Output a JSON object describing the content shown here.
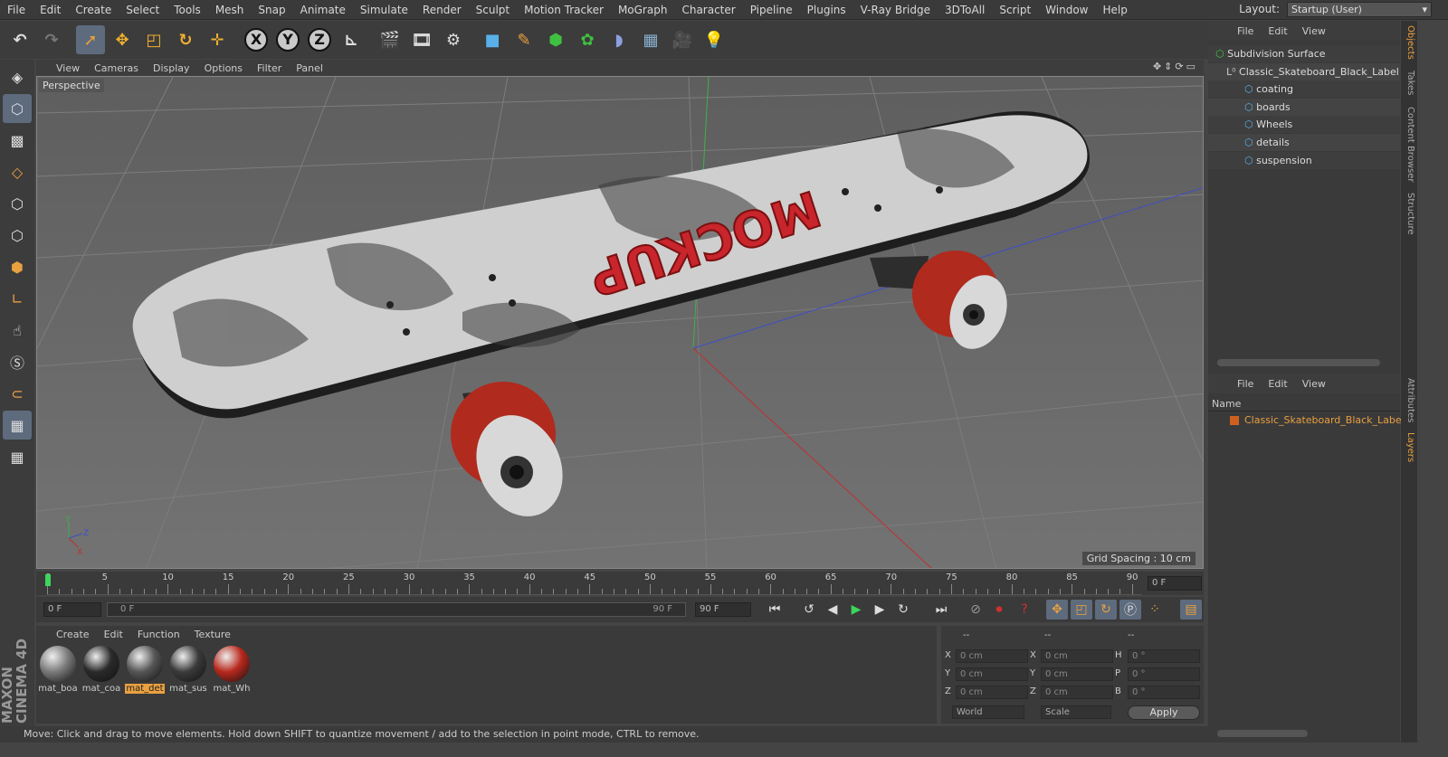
{
  "menu": [
    "File",
    "Edit",
    "Create",
    "Select",
    "Tools",
    "Mesh",
    "Snap",
    "Animate",
    "Simulate",
    "Render",
    "Sculpt",
    "Motion Tracker",
    "MoGraph",
    "Character",
    "Pipeline",
    "Plugins",
    "V-Ray Bridge",
    "3DToAll",
    "Script",
    "Window",
    "Help"
  ],
  "layout": {
    "label": "Layout:",
    "value": "Startup (User)"
  },
  "toolbar": {
    "x": "X",
    "y": "Y",
    "z": "Z"
  },
  "viewport": {
    "menu": [
      "View",
      "Cameras",
      "Display",
      "Options",
      "Filter",
      "Panel"
    ],
    "label": "Perspective",
    "grid_spacing": "Grid Spacing : 10 cm",
    "mockup_text": "MOCKUP"
  },
  "timeline": {
    "ticks": [
      "0",
      "5",
      "10",
      "15",
      "20",
      "25",
      "30",
      "35",
      "40",
      "45",
      "50",
      "55",
      "60",
      "65",
      "70",
      "75",
      "80",
      "85",
      "90"
    ],
    "current": "0 F",
    "start": "0 F",
    "slider_left": "0 F",
    "slider_right": "90 F",
    "end": "90 F"
  },
  "materials": {
    "menu": [
      "Create",
      "Edit",
      "Function",
      "Texture"
    ],
    "items": [
      {
        "label": "mat_boa",
        "color": "#7a7a7a"
      },
      {
        "label": "mat_coa",
        "color": "#2a2a2a"
      },
      {
        "label": "mat_det",
        "color": "#555555"
      },
      {
        "label": "mat_sus",
        "color": "#3a3a3a"
      },
      {
        "label": "mat_Wh",
        "color": "#b8281c"
      }
    ]
  },
  "coords": {
    "headers": [
      "--",
      "--",
      "--"
    ],
    "rows": [
      {
        "a": "X",
        "av": "0 cm",
        "b": "X",
        "bv": "0 cm",
        "c": "H",
        "cv": "0 °"
      },
      {
        "a": "Y",
        "av": "0 cm",
        "b": "Y",
        "bv": "0 cm",
        "c": "P",
        "cv": "0 °"
      },
      {
        "a": "Z",
        "av": "0 cm",
        "b": "Z",
        "bv": "0 cm",
        "c": "B",
        "cv": "0 °"
      }
    ],
    "world": "World",
    "scale": "Scale",
    "apply": "Apply"
  },
  "status": "Move: Click and drag to move elements. Hold down SHIFT to quantize movement / add to the selection in point mode, CTRL to remove.",
  "brand": "MAXON CINEMA 4D",
  "objects": {
    "menu": [
      "File",
      "Edit",
      "View"
    ],
    "tree": [
      {
        "label": "Subdivision Surface"
      },
      {
        "label": "Classic_Skateboard_Black_Label"
      },
      {
        "label": "coating"
      },
      {
        "label": "boards"
      },
      {
        "label": "Wheels"
      },
      {
        "label": "details"
      },
      {
        "label": "suspension"
      }
    ]
  },
  "layers": {
    "menu": [
      "File",
      "Edit",
      "View"
    ],
    "header": "Name",
    "row": "Classic_Skateboard_Black_Label",
    "row_color": "#e9a040"
  },
  "right_tabs": [
    "Objects",
    "Takes",
    "Content Browser",
    "Structure",
    "Attributes",
    "Layers"
  ]
}
